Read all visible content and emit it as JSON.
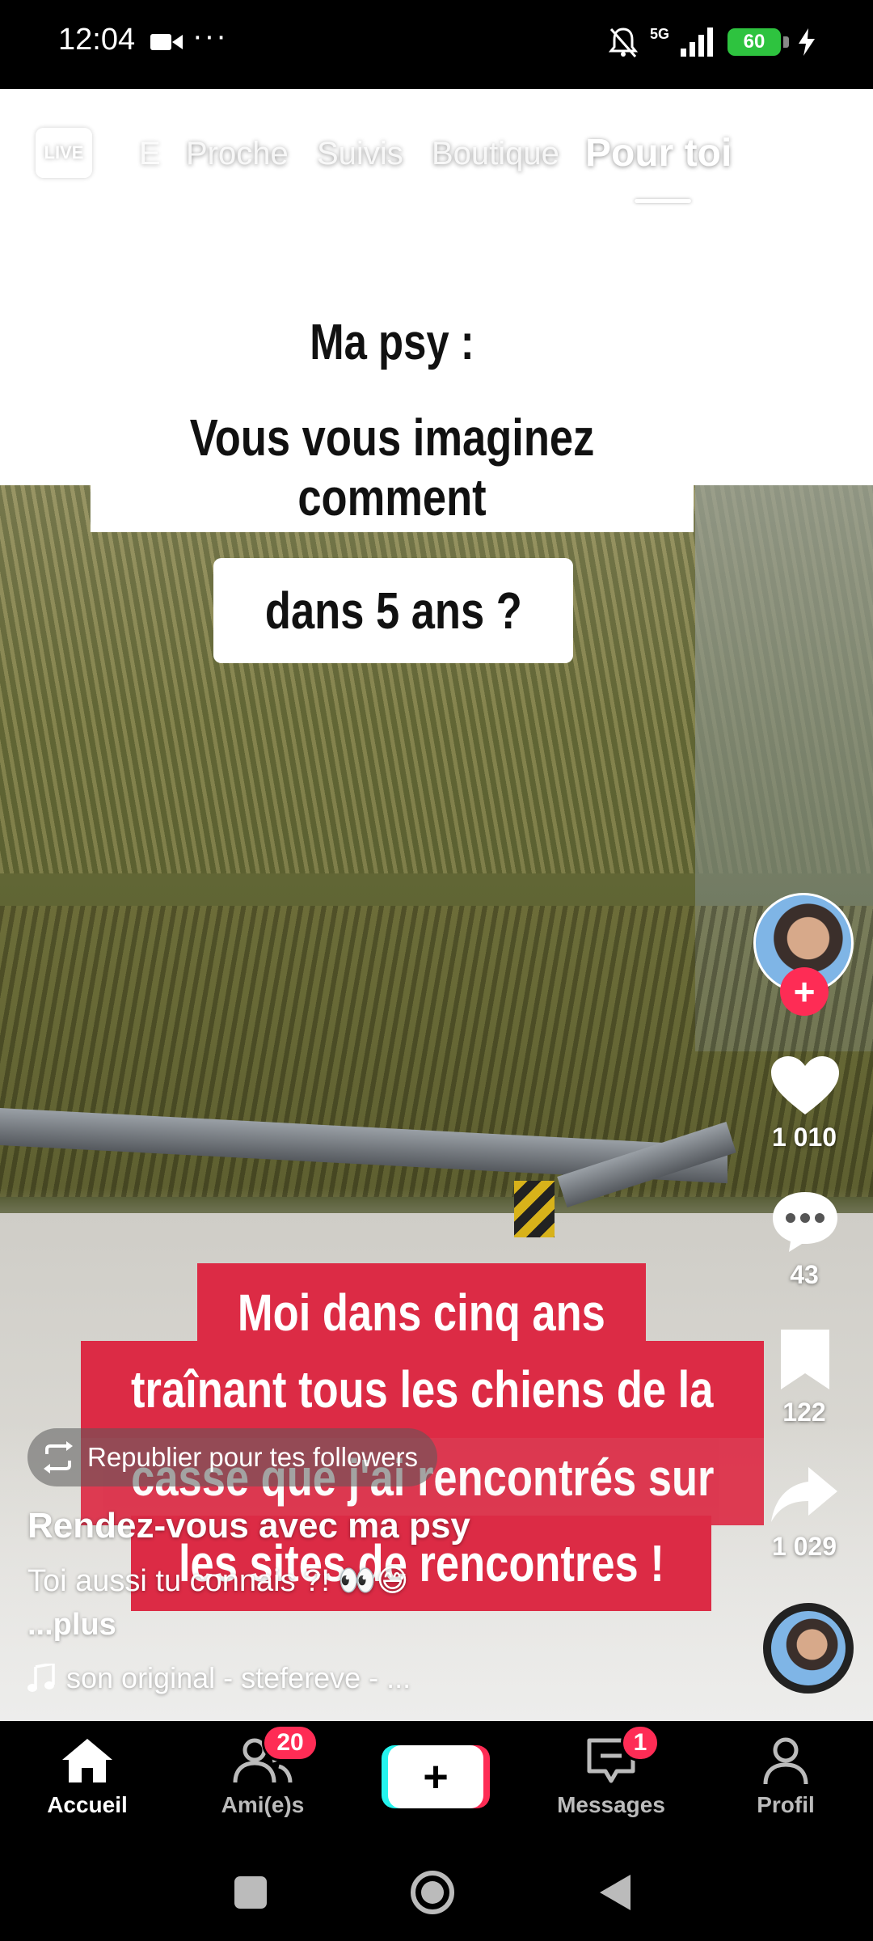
{
  "status_bar": {
    "time": "12:04",
    "more": "···",
    "network": "5G",
    "battery": "60"
  },
  "top_nav": {
    "live_label": "LIVE",
    "tabs": [
      "E",
      "Proche",
      "Suivis",
      "Boutique",
      "Pour toi"
    ],
    "active_tab": "Pour toi"
  },
  "video": {
    "caption_top": [
      "Ma psy :",
      "Vous vous imaginez comment",
      "dans 5 ans ?"
    ],
    "caption_bottom": [
      "Moi dans cinq ans",
      "traînant tous les chiens de la",
      "casse que j'ai rencontrés sur",
      "les sites de rencontres !"
    ]
  },
  "actions": {
    "likes": "1 010",
    "comments": "43",
    "saves": "122",
    "shares": "1 029"
  },
  "post": {
    "republish_label": "Republier pour tes followers",
    "title": "Rendez-vous avec ma psy",
    "description": "Toi aussi tu connais ?! 👀😅",
    "more_label": "...plus",
    "sound": "son original - stefereve - ..."
  },
  "tab_bar": {
    "home": "Accueil",
    "friends": "Ami(e)s",
    "friends_badge": "20",
    "create": "+",
    "messages": "Messages",
    "messages_badge": "1",
    "profile": "Profil"
  },
  "colors": {
    "accent": "#fe2c55",
    "caption_red": "#dc2b45",
    "cyan": "#25f4ee",
    "battery_green": "#2ec33f"
  }
}
